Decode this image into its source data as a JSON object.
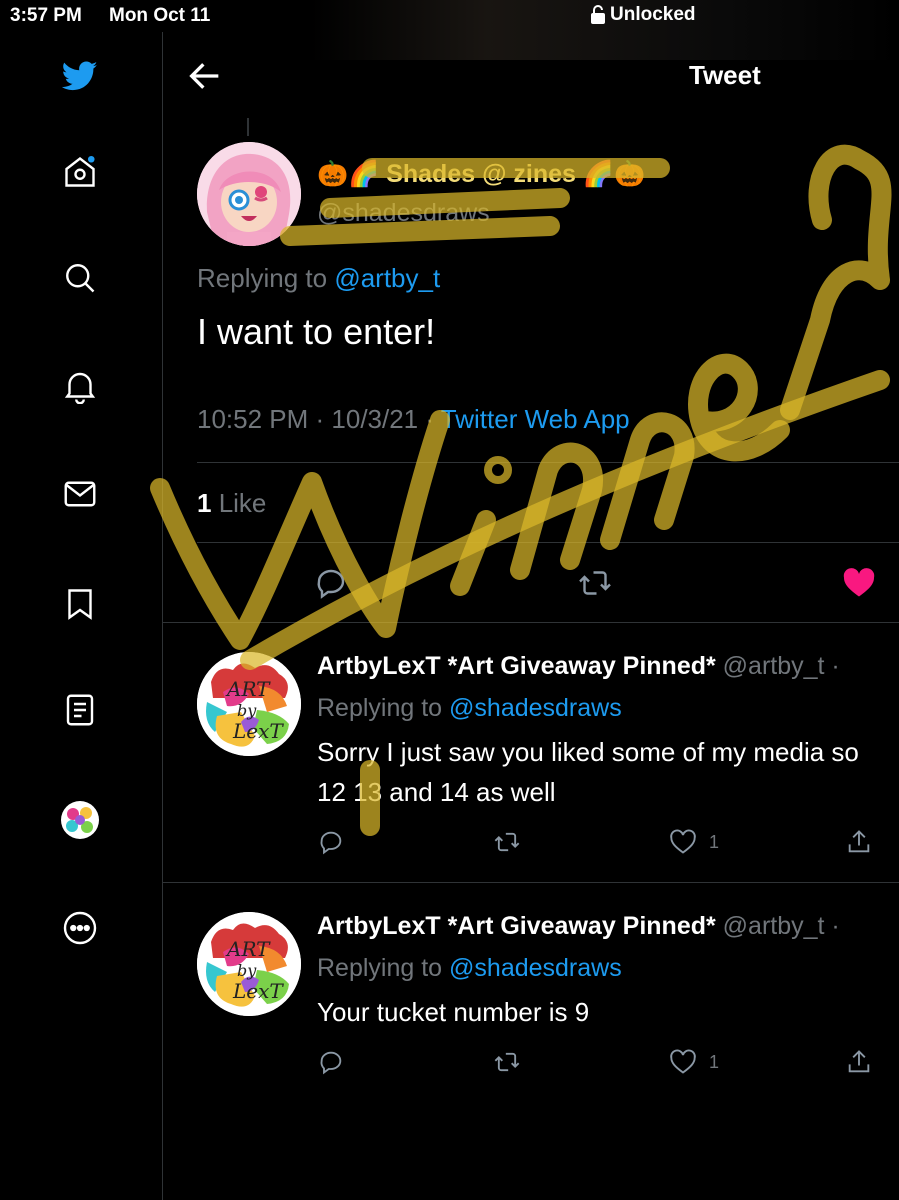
{
  "status_bar": {
    "time": "3:57 PM",
    "date": "Mon Oct 11",
    "lock_label": "Unlocked"
  },
  "sidebar": {
    "items": [
      {
        "icon": "twitter-logo-icon"
      },
      {
        "icon": "home-icon"
      },
      {
        "icon": "search-icon"
      },
      {
        "icon": "notifications-icon"
      },
      {
        "icon": "messages-icon"
      },
      {
        "icon": "bookmarks-icon"
      },
      {
        "icon": "lists-icon"
      },
      {
        "icon": "profile-avatar"
      },
      {
        "icon": "more-icon"
      }
    ]
  },
  "header": {
    "title": "Tweet"
  },
  "tweet": {
    "display_name": "🎃🌈 Shades @ zines 🌈🎃",
    "handle": "@shadesdraws",
    "replying_prefix": "Replying to ",
    "replying_handle": "@artby_t",
    "text": "I want to enter!",
    "time": "10:52 PM · 10/3/21 · ",
    "source": "Twitter Web App",
    "like_count": "1",
    "like_label": " Like"
  },
  "replies": [
    {
      "name": "ArtbyLexT *Art Giveaway Pinned*",
      "handle": " @artby_t ·",
      "replying_prefix": "Replying to ",
      "replying_handle": "@shadesdraws",
      "line1": "Sorry I just saw you liked some of my media so",
      "line2": "12 13 and 14 as well",
      "like_count": "1"
    },
    {
      "name": "ArtbyLexT *Art Giveaway Pinned*",
      "handle": " @artby_t ·",
      "replying_prefix": "Replying to ",
      "replying_handle": "@shadesdraws",
      "line1": "Your tucket number is 9",
      "like_count": "1"
    }
  ],
  "annotation": {
    "text": "Winner"
  },
  "colors": {
    "accent": "#1d9bf0",
    "like": "#f91880",
    "marker": "#d9b72a",
    "background": "#000000"
  }
}
